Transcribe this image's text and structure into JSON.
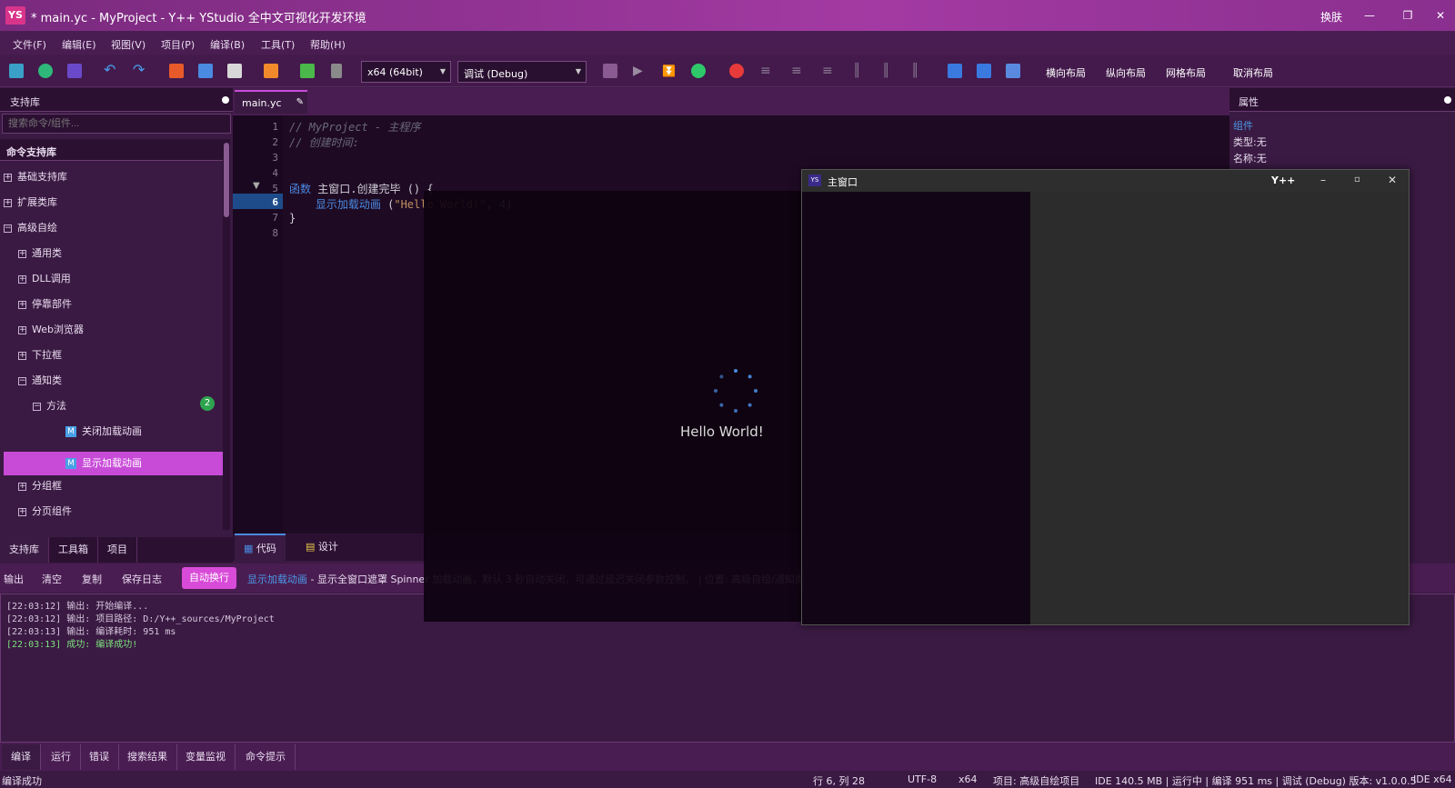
{
  "window": {
    "logo": "YS",
    "title": "* main.yc - MyProject - Y++ YStudio 全中文可视化开发环境",
    "skin_label": "换肤",
    "minimize": "—",
    "maximize": "❐",
    "close": "✕"
  },
  "menu": [
    "文件(F)",
    "编辑(E)",
    "视图(V)",
    "项目(P)",
    "编译(B)",
    "工具(T)",
    "帮助(H)"
  ],
  "toolbar": {
    "platform": "x64 (64bit)",
    "config": "调试 (Debug)",
    "layout_buttons": [
      "横向布局",
      "纵向布局",
      "网格布局",
      "取消布局"
    ]
  },
  "library": {
    "header": "支持库",
    "search_placeholder": "搜索命令/组件...",
    "section": "命令支持库",
    "tree": [
      {
        "label": "基础支持库",
        "level": 0,
        "exp": "+"
      },
      {
        "label": "扩展类库",
        "level": 0,
        "exp": "+"
      },
      {
        "label": "高级自绘",
        "level": 0,
        "exp": "−"
      },
      {
        "label": "通用类",
        "level": 1,
        "exp": "+"
      },
      {
        "label": "DLL调用",
        "level": 1,
        "exp": "+"
      },
      {
        "label": "停靠部件",
        "level": 1,
        "exp": "+"
      },
      {
        "label": "Web浏览器",
        "level": 1,
        "exp": "+"
      },
      {
        "label": "下拉框",
        "level": 1,
        "exp": "+"
      },
      {
        "label": "通知类",
        "level": 1,
        "exp": "−"
      },
      {
        "label": "方法",
        "level": 2,
        "exp": "−"
      },
      {
        "label": "关闭加载动画",
        "level": 3,
        "exp": "M"
      },
      {
        "label": "显示加载动画",
        "level": 3,
        "exp": "M"
      },
      {
        "label": "分组框",
        "level": 1,
        "exp": "+"
      },
      {
        "label": "分页组件",
        "level": 1,
        "exp": "+"
      }
    ],
    "methods_badge": "2",
    "tabs": [
      "支持库",
      "工具箱",
      "项目"
    ]
  },
  "editor": {
    "tab": "main.yc",
    "tab_icon": "✎",
    "line_numbers": [
      "1",
      "2",
      "3",
      "4",
      "5",
      "6",
      "7",
      "8"
    ],
    "lines": {
      "l1": "// MyProject - 主程序",
      "l2": "// 创建时间:",
      "l5_kw": "函数",
      "l5_rest": " 主窗口.创建完毕 () {",
      "l6_fn": "    显示加载动画",
      "l6_p1": " (",
      "l6_str": "\"Hello World!\"",
      "l6_p2": ", ",
      "l6_num": "4",
      "l6_p3": ")",
      "l7": "}"
    },
    "view_tabs": [
      "代码",
      "设计"
    ]
  },
  "properties": {
    "header": "属性",
    "section": "组件",
    "type": "类型:无",
    "name": "名称:无"
  },
  "output": {
    "buttons": [
      "输出",
      "清空",
      "复制",
      "保存日志"
    ],
    "autowrap": "自动换行",
    "hint_link": "显示加载动画",
    "hint_text": " - 显示全窗口遮罩 Spinner 加载动画，默认 3 秒自动关闭，可通过延迟关闭参数控制。 | 位置: 高级自绘/通知类",
    "logs": [
      "[22:03:12] 输出: 开始编译...",
      "[22:03:12] 输出: 项目路径: D:/Y++_sources/MyProject",
      "[22:03:13] 输出: 编译耗时: 951 ms",
      "[22:03:13] 成功: 编译成功!"
    ],
    "tabs": [
      "编译",
      "运行",
      "错误",
      "搜索结果",
      "变量监视",
      "命令提示"
    ]
  },
  "status": {
    "left": "编译成功",
    "position": "行 6, 列 28",
    "encoding": "UTF-8",
    "arch": "x64",
    "project": "项目: 高级自绘项目",
    "info": "IDE 140.5 MB | 运行中 | 编译 951 ms | 调试 (Debug) 版本: v1.0.0.5",
    "ide": "IDE x64"
  },
  "popup": {
    "logo": "YS",
    "title": "主窗口",
    "brand": "Y++",
    "loading_text": "Hello World!"
  },
  "colors": {
    "accent": "#c84bd8",
    "titlebar": "#a33aa3",
    "success": "#7ee07e",
    "spinner": "#4a8ae0"
  }
}
